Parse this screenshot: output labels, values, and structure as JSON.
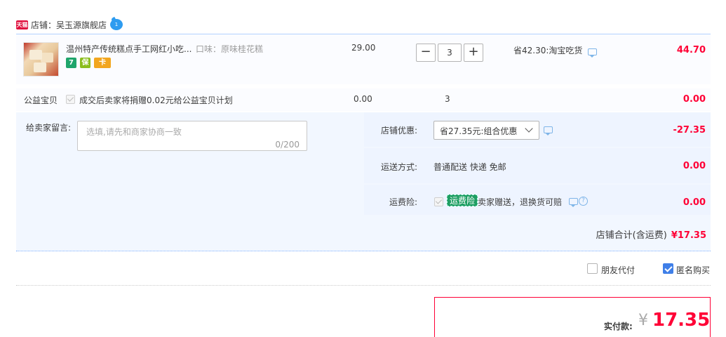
{
  "shop": {
    "badge": "天猫",
    "label": "店铺：吴玉源旗舰店",
    "ww_badge": "1"
  },
  "item": {
    "title": "温州特产传统糕点手工网红小吃...",
    "sku": "口味：原味桂花糕",
    "service_icons": [
      "7-day-return-icon",
      "guarantee-icon",
      "credit-card-icon"
    ],
    "service_7": "7",
    "service_b": "保",
    "service_c": "卡",
    "price": "29.00",
    "quantity": "3",
    "qty_minus": "−",
    "qty_plus": "+",
    "discount": "省42.30:淘宝吃货",
    "subtotal": "44.70"
  },
  "charity": {
    "label": "公益宝贝",
    "desc": "成交后卖家将捐赠0.02元给公益宝贝计划",
    "price": "0.00",
    "quantity": "3",
    "total": "0.00"
  },
  "message": {
    "label": "给卖家留言:",
    "placeholder": "选填,请先和商家协商一致",
    "count": "0/200"
  },
  "promo": {
    "label": "店铺优惠:",
    "selected": "省27.35元:组合优惠",
    "value": "-27.35"
  },
  "shipping": {
    "label": "运送方式:",
    "text": "普通配送 快递 免邮",
    "value": "0.00"
  },
  "insurance": {
    "label": "运费险:",
    "tag": "运费险",
    "text": "卖家赠送，退换货可赔",
    "help": "?",
    "value": "0.00"
  },
  "shop_total": {
    "label": "店铺合计(含运费)",
    "value": "¥17.35"
  },
  "options": {
    "friend_pay": "朋友代付",
    "anonymous": "匿名购买"
  },
  "payment": {
    "label": "实付款:",
    "currency": "¥",
    "amount": "17.35"
  },
  "colors": {
    "accent_red": "#ff0036",
    "tmall_red": "#e0123f",
    "panel_bg": "#f2f7ff",
    "check_blue": "#3f7fe8",
    "insurance_green": "#1e9e63"
  }
}
